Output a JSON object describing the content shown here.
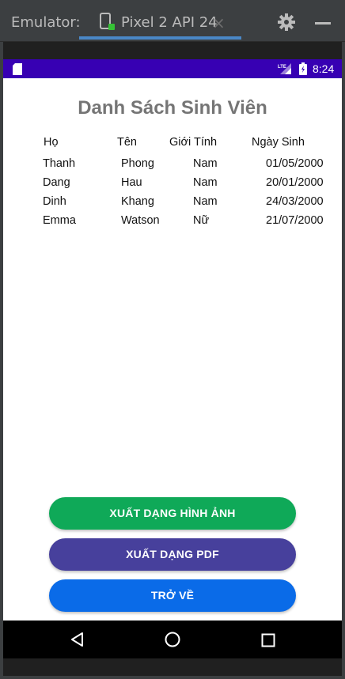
{
  "emulator": {
    "label": "Emulator:",
    "tab_label": "Pixel 2 API 24",
    "tab_close": "×"
  },
  "statusbar": {
    "time": "8:24",
    "network": "LTE"
  },
  "app": {
    "title": "Danh Sách Sinh Viên",
    "columns": [
      "Họ",
      "Tên",
      "Giới Tính",
      "Ngày Sinh"
    ],
    "rows": [
      [
        "Thanh",
        "Phong",
        "Nam",
        "01/05/2000"
      ],
      [
        "Dang",
        "Hau",
        "Nam",
        "20/01/2000"
      ],
      [
        "Dinh",
        "Khang",
        "Nam",
        "24/03/2000"
      ],
      [
        "Emma",
        "Watson",
        "Nữ",
        "21/07/2000"
      ]
    ],
    "buttons": {
      "export_image": "XUẤT DẠNG HÌNH ẢNH",
      "export_pdf": "XUẤT DẠNG PDF",
      "back": "TRỞ VỀ"
    }
  },
  "colors": {
    "status_bar": "#3700b3",
    "btn_image": "#0fa958",
    "btn_pdf": "#47409c",
    "btn_back": "#0a6be8",
    "title_text": "#757575"
  },
  "icons": [
    "device-icon",
    "close-icon",
    "gear-icon",
    "minimize-icon",
    "sd-card-icon",
    "lte-signal-icon",
    "battery-icon",
    "back-icon",
    "home-icon",
    "recents-icon"
  ]
}
